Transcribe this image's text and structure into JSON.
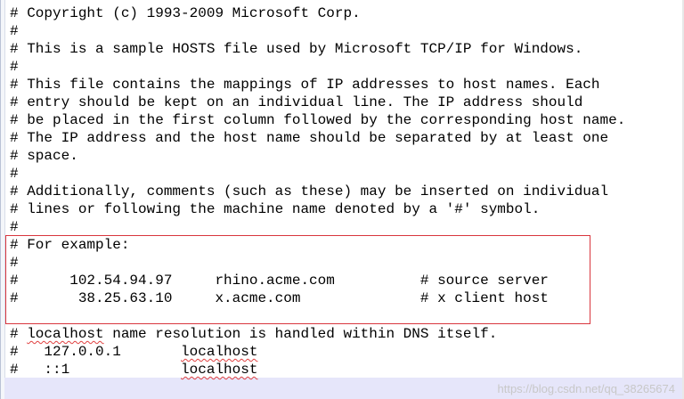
{
  "editor": {
    "lines": [
      "# Copyright (c) 1993-2009 Microsoft Corp.",
      "#",
      "# This is a sample HOSTS file used by Microsoft TCP/IP for Windows.",
      "#",
      "# This file contains the mappings of IP addresses to host names. Each",
      "# entry should be kept on an individual line. The IP address should",
      "# be placed in the first column followed by the corresponding host name.",
      "# The IP address and the host name should be separated by at least one",
      "# space.",
      "#",
      "# Additionally, comments (such as these) may be inserted on individual",
      "# lines or following the machine name denoted by a '#' symbol.",
      "#",
      "# For example:",
      "#",
      "#      102.54.94.97     rhino.acme.com          # source server",
      "#       38.25.63.10     x.acme.com              # x client host",
      "",
      "# localhost name resolution is handled within DNS itself.",
      "#   127.0.0.1       localhost",
      "#   ::1             localhost"
    ],
    "line18_pre": "# ",
    "line18_word": "localhost",
    "line18_post": " name resolution is handled within DNS itself.",
    "line19_pre": "#   127.0.0.1       ",
    "line19_word": "localhost",
    "line20_pre": "#   ::1             ",
    "line20_word": "localhost"
  },
  "watermark": "https://blog.csdn.net/qq_38265674",
  "colors": {
    "highlight_box": "#d9363e",
    "current_line": "#e6e6fa",
    "spell_underline": "#e04040"
  }
}
